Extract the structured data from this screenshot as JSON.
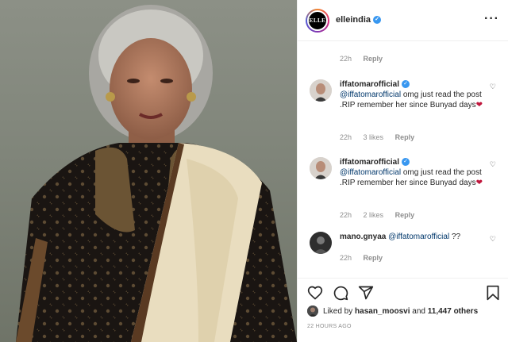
{
  "account": {
    "avatar_text": "ELLE",
    "username": "elleindia",
    "verified_mark": "✓",
    "more_icon": "more-horizontal-icon"
  },
  "comments": [
    {
      "id": "c0",
      "time": "22h",
      "likes": "",
      "reply": "Reply"
    },
    {
      "id": "c1",
      "username": "iffatomarofficial",
      "mention": "@iffatomarofficial",
      "text": " omg just read the post .RIP remember her since Bunyad days",
      "emoji": "❤",
      "time": "22h",
      "likes": "3 likes",
      "reply": "Reply"
    },
    {
      "id": "c2",
      "username": "iffatomarofficial",
      "mention": "@iffatomarofficial",
      "text": " omg just read the post .RIP remember her since Bunyad days",
      "emoji": "❤",
      "time": "22h",
      "likes": "2 likes",
      "reply": "Reply"
    },
    {
      "id": "c3",
      "username": "mano.gnyaa",
      "mention": "@iffatomarofficial",
      "text": " ??",
      "time": "22h",
      "reply": "Reply"
    }
  ],
  "actions": {
    "like": "heart-icon",
    "comment": "comment-icon",
    "share": "share-icon",
    "save": "bookmark-icon"
  },
  "likes_line": {
    "prefix": "Liked by ",
    "user": "hasan_moosvi",
    "middle": " and ",
    "count": "11,447 others"
  },
  "timestamp": "22 HOURS AGO",
  "colors": {
    "accent": "#3897f0",
    "mention": "#00376b",
    "muted": "#8e8e8e",
    "heart": "#c0163c"
  }
}
